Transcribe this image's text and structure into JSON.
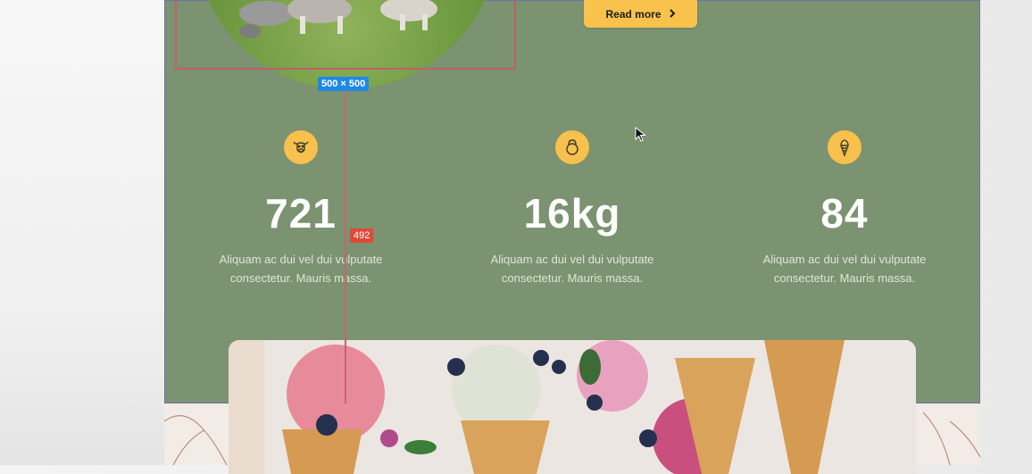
{
  "hero": {
    "read_more_label": "Read more",
    "image_size_label": "500 × 500"
  },
  "editor": {
    "guide_distance_label": "492"
  },
  "stats": [
    {
      "icon": "cow-icon",
      "value": "721",
      "description_line1": "Aliquam ac dui vel dui vulputate",
      "description_line2": "consectetur. Mauris massa."
    },
    {
      "icon": "kettlebell-icon",
      "value": "16kg",
      "description_line1": "Aliquam ac dui vel dui vulputate",
      "description_line2": "consectetur. Mauris massa."
    },
    {
      "icon": "ice-cream-icon",
      "value": "84",
      "description_line1": "Aliquam ac dui vel dui vulputate",
      "description_line2": "consectetur. Mauris massa."
    }
  ],
  "colors": {
    "section_background": "#7b9370",
    "accent_yellow": "#f9c24d",
    "selection_red": "#c0606a",
    "size_badge_blue": "#1e88e5"
  }
}
